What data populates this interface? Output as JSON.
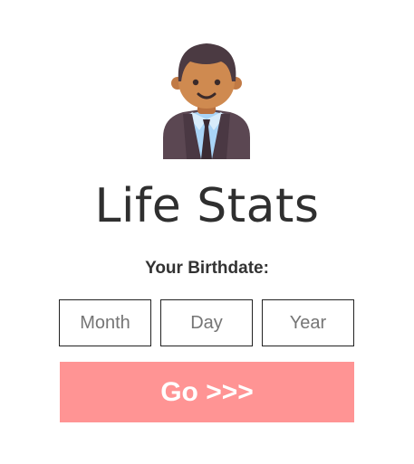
{
  "header": {
    "avatar_icon": "businessman-avatar-icon",
    "title": "Life Stats"
  },
  "form": {
    "label": "Your Birthdate:",
    "month_placeholder": "Month",
    "day_placeholder": "Day",
    "year_placeholder": "Year",
    "month_value": "",
    "day_value": "",
    "year_value": ""
  },
  "submit": {
    "label": "Go >>>",
    "color": "#ff9494"
  }
}
